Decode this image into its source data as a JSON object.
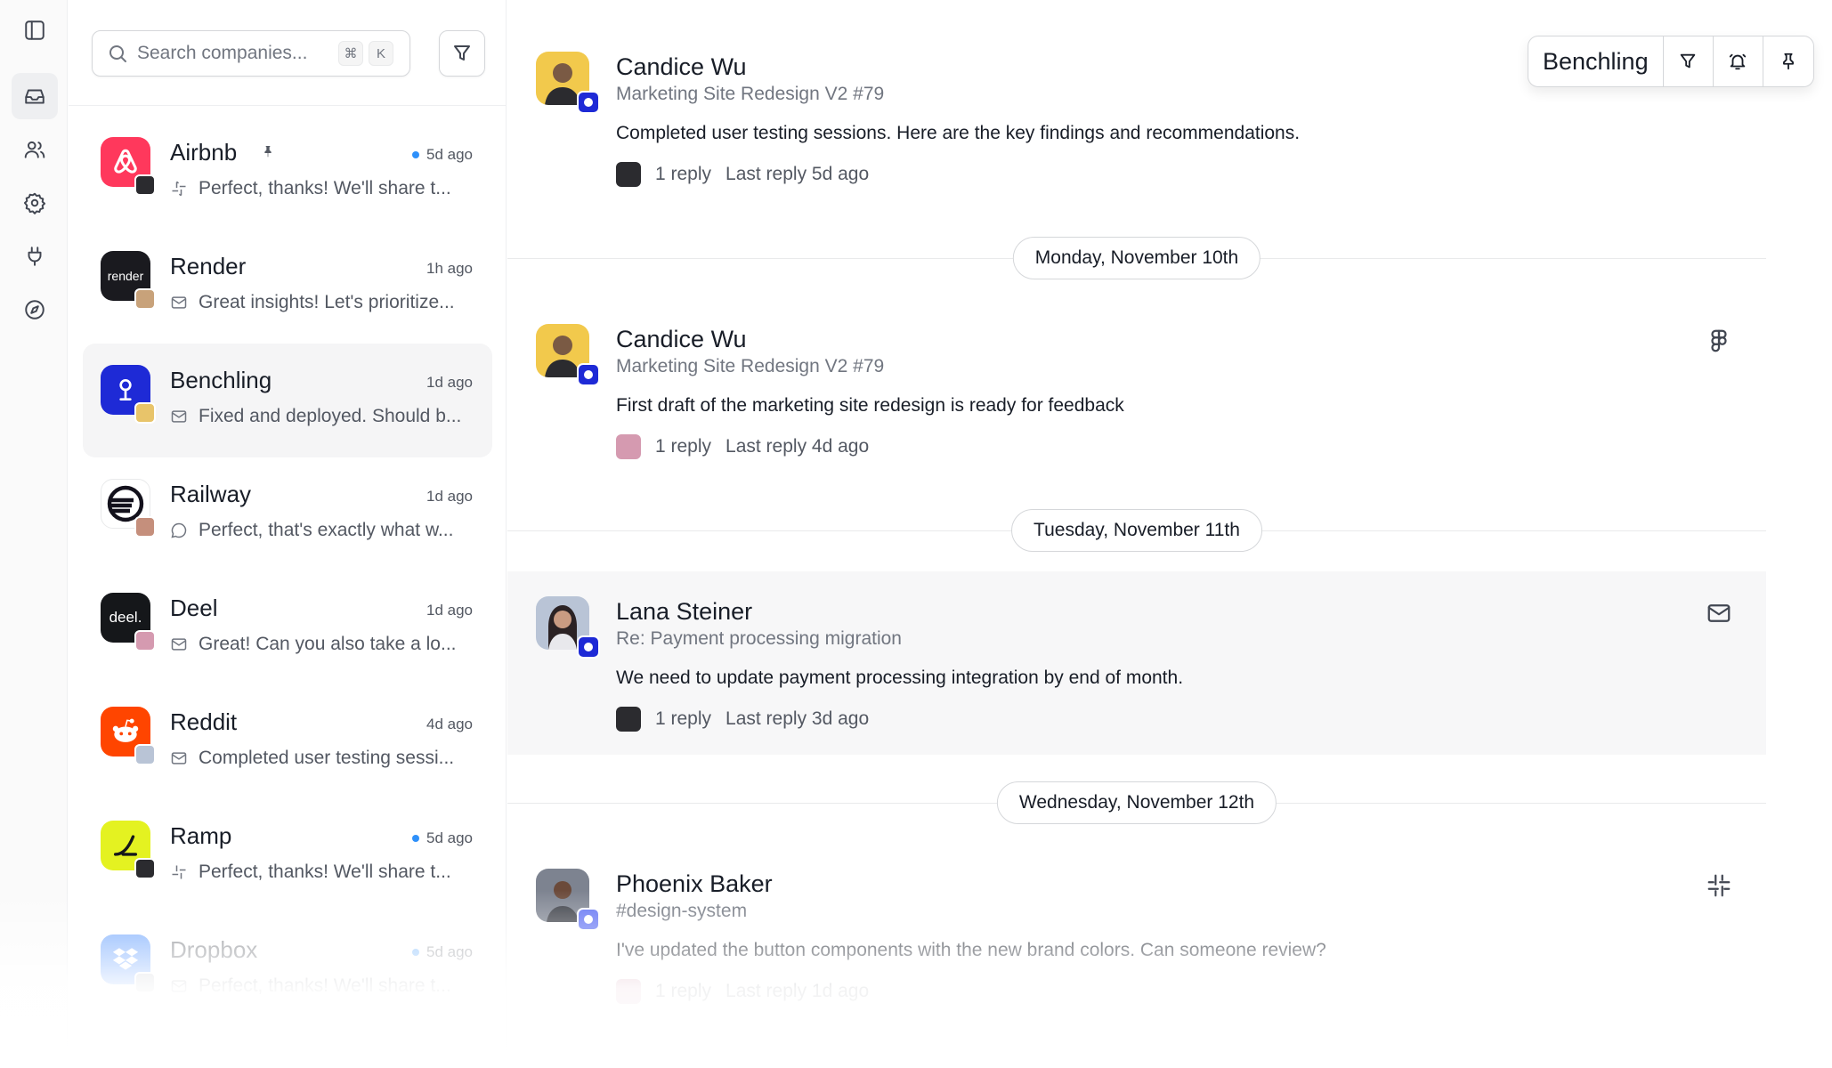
{
  "search": {
    "placeholder": "Search companies...",
    "kbd_cmd": "⌘",
    "kbd_key": "K"
  },
  "companies": [
    {
      "name": "Airbnb",
      "time": "5d ago",
      "unread": true,
      "pinned": true,
      "preview": "Perfect, thanks! We'll share t...",
      "preview_icon": "slack-icon",
      "logo_bg": "#ff385c",
      "logo_text": ""
    },
    {
      "name": "Render",
      "time": "1h ago",
      "unread": false,
      "pinned": false,
      "preview": "Great insights! Let's prioritize...",
      "preview_icon": "mail-icon",
      "logo_bg": "#1a1a1f",
      "logo_text": "render"
    },
    {
      "name": "Benchling",
      "time": "1d ago",
      "unread": false,
      "pinned": false,
      "preview": "Fixed and deployed. Should b...",
      "preview_icon": "mail-icon",
      "logo_bg": "#1e2ad6",
      "logo_text": ""
    },
    {
      "name": "Railway",
      "time": "1d ago",
      "unread": false,
      "pinned": false,
      "preview": "Perfect, that's exactly what w...",
      "preview_icon": "chat-icon",
      "logo_bg": "#13111c",
      "logo_text": ""
    },
    {
      "name": "Deel",
      "time": "1d ago",
      "unread": false,
      "pinned": false,
      "preview": "Great! Can you also take a lo...",
      "preview_icon": "mail-icon",
      "logo_bg": "#15171a",
      "logo_text": "deel."
    },
    {
      "name": "Reddit",
      "time": "4d ago",
      "unread": false,
      "pinned": false,
      "preview": "Completed user testing sessi...",
      "preview_icon": "mail-icon",
      "logo_bg": "#ff4500",
      "logo_text": ""
    },
    {
      "name": "Ramp",
      "time": "5d ago",
      "unread": true,
      "pinned": false,
      "preview": "Perfect, thanks! We'll share t...",
      "preview_icon": "slack-icon",
      "logo_bg": "#e4f221",
      "logo_text": ""
    },
    {
      "name": "Dropbox",
      "time": "5d ago",
      "unread": true,
      "pinned": false,
      "preview": "Perfect, thanks! We'll share t...",
      "preview_icon": "mail-icon",
      "logo_bg": "#0061fe",
      "logo_text": ""
    }
  ],
  "header": {
    "company": "Benchling"
  },
  "feed": {
    "messages": [
      {
        "author": "Candice Wu",
        "subtitle": "Marketing Site Redesign V2 #79",
        "body": "Completed user testing sessions. Here are the key findings and recommendations.",
        "replies": "1 reply",
        "last_reply": "Last reply 5d ago",
        "source_icon": "",
        "avatar_bg": "#f2c94c"
      },
      {
        "author": "Candice Wu",
        "subtitle": "Marketing Site Redesign V2 #79",
        "body": "First draft of the marketing site redesign is ready for feedback",
        "replies": "1 reply",
        "last_reply": "Last reply 4d ago",
        "source_icon": "figma-icon",
        "avatar_bg": "#f2c94c"
      },
      {
        "author": "Lana Steiner",
        "subtitle": "Re: Payment processing migration",
        "body": "We need to update payment processing integration by end of month.",
        "replies": "1 reply",
        "last_reply": "Last reply 3d ago",
        "source_icon": "mail-icon",
        "avatar_bg": "#b9c4d6"
      },
      {
        "author": "Phoenix Baker",
        "subtitle": "#design-system",
        "body": "I've updated the button components with the new brand colors. Can someone review?",
        "replies": "1 reply",
        "last_reply": "Last reply 1d ago",
        "source_icon": "slack-icon",
        "avatar_bg": "#7d8390"
      }
    ],
    "dates": [
      "Monday, November 10th",
      "Tuesday, November 11th",
      "Wednesday, November 12th"
    ]
  },
  "colors": {
    "accent": "#2e90fa",
    "badge": "#1e2ad6",
    "selected_bg": "#f5f5f6"
  }
}
